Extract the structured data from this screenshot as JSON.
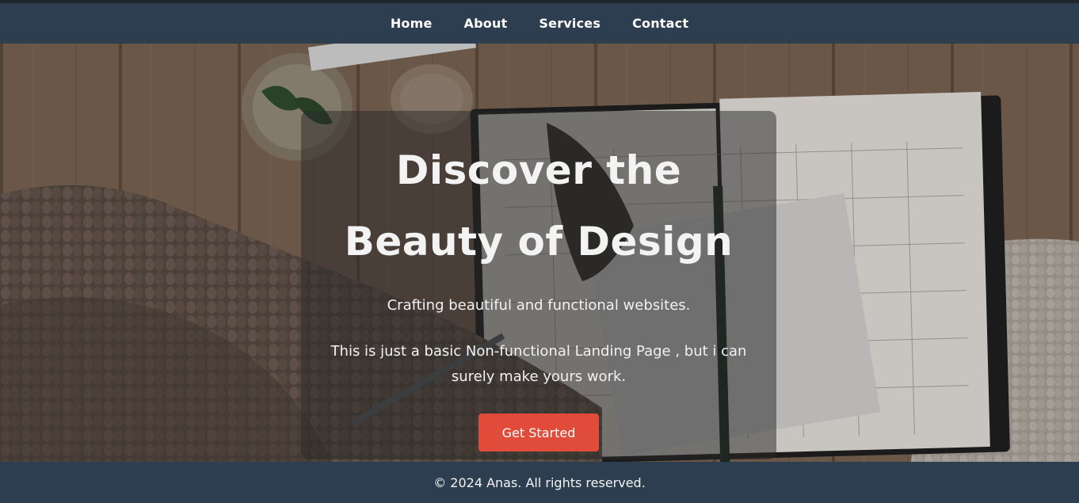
{
  "nav": {
    "links": [
      "Home",
      "About",
      "Services",
      "Contact"
    ]
  },
  "hero": {
    "title_line1": "Discover the",
    "title_line2": "Beauty of Design",
    "subtitle": "Crafting beautiful and functional websites.",
    "description": "This is just a basic Non-functional Landing Page , but i can surely make yours work.",
    "cta_label": "Get Started"
  },
  "footer": {
    "text": "© 2024 Anas. All rights reserved."
  },
  "colors": {
    "nav_background": "#2c3e50",
    "footer_background": "#2c3e50",
    "cta_background": "#e04b3a",
    "text": "#ffffff"
  }
}
